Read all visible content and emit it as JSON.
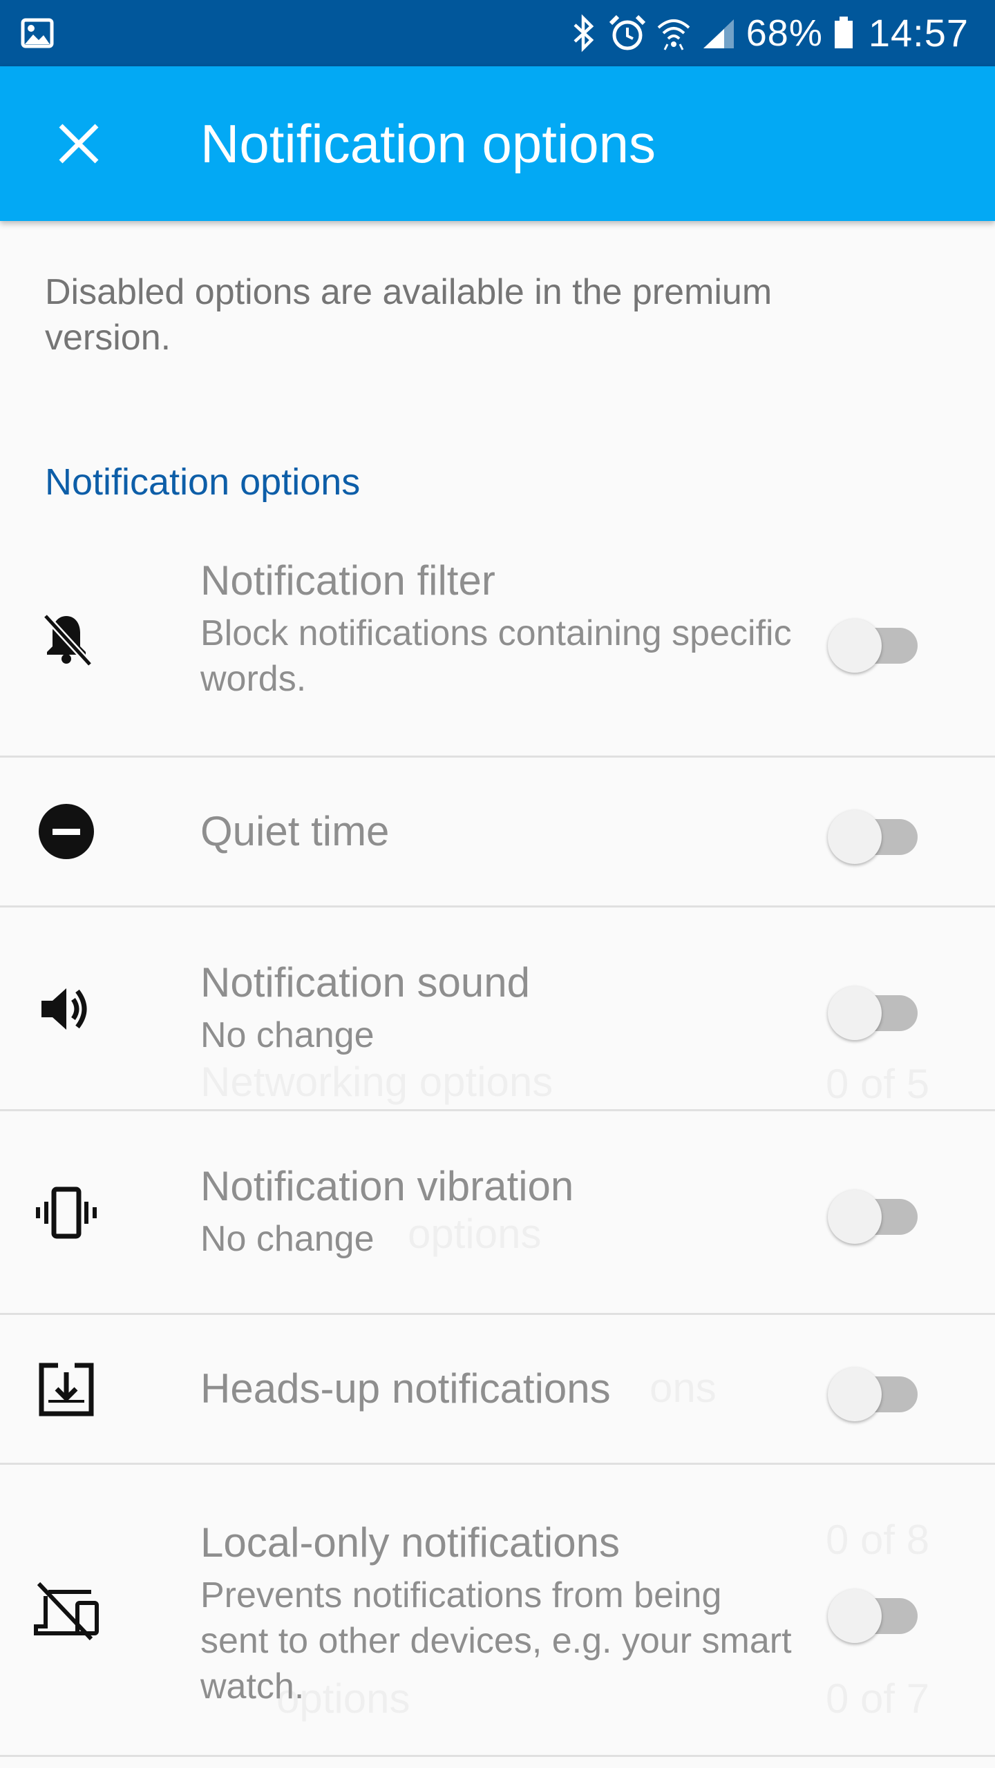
{
  "status_bar": {
    "battery_percent": "68%",
    "time": "14:57",
    "icons": [
      "gallery-icon",
      "bluetooth-icon",
      "alarm-icon",
      "wifi-icon",
      "signal-icon",
      "battery-icon"
    ]
  },
  "appbar": {
    "title": "Notification options",
    "close_icon": "close-icon"
  },
  "info_text": "Disabled options are available in the premium version.",
  "section_header": "Notification options",
  "settings": [
    {
      "title": "Notification filter",
      "subtitle": "Block notifications containing specific words.",
      "icon": "bell-off-icon",
      "enabled": false
    },
    {
      "title": "Quiet time",
      "subtitle": "",
      "icon": "do-not-disturb-icon",
      "enabled": false
    },
    {
      "title": "Notification sound",
      "subtitle": "No change",
      "icon": "volume-icon",
      "enabled": false
    },
    {
      "title": "Notification vibration",
      "subtitle": "No change",
      "icon": "vibration-icon",
      "enabled": false
    },
    {
      "title": "Heads-up notifications",
      "subtitle": "",
      "icon": "heads-up-icon",
      "enabled": false
    },
    {
      "title": "Local-only notifications",
      "subtitle": "Prevents notifications from being sent to other devices, e.g. your smart watch.",
      "icon": "devices-off-icon",
      "enabled": false
    }
  ],
  "background_ghost": {
    "networking": "Networking options",
    "networking_count": "0 of 5",
    "options_1": "options",
    "options_2": "ons",
    "count_3": "0 of 8",
    "options_3": "options",
    "count_4": "0 of 7"
  }
}
